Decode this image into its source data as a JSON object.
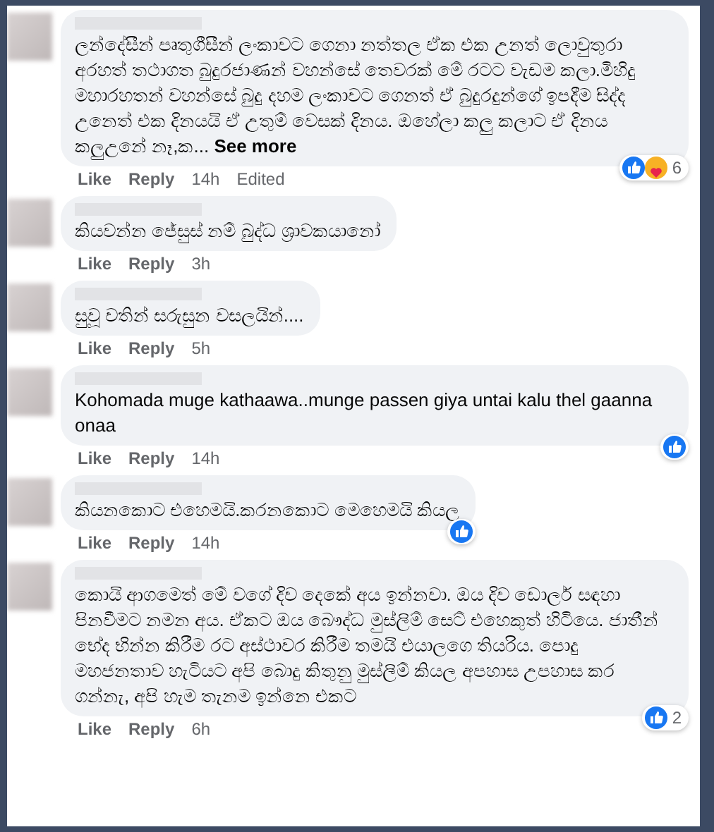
{
  "comments": [
    {
      "text": "ලන්දේසීන් පෘතුගීසීන් ලංකාවට ගෙනා නත්තල ඒක එක උනත් ලොවුතුරා අරහත් තථාගත බුදුරජාණන් වහන්සේ තෙවරක් මේ රටට වැඩම කලා.මිහිදු මහාරහතන් වහන්සේ බුදු දහම ලංකාවට ගෙනත් ඒ බුදුරදුන්ගේ ඉපදීම සිද්ද උනෙත් එක දිනයයි ඒ උතුම් වෙසක් දිනය. ඔහේලා කලු කලාට ඒ දිනය කලුඋනේ නෑ,ක...",
      "see_more": "See more",
      "like": "Like",
      "reply": "Reply",
      "time": "14h",
      "edited": "Edited",
      "reactions": [
        {
          "kind": "like"
        },
        {
          "kind": "care"
        }
      ],
      "reaction_count": "6"
    },
    {
      "text": "කියවන්න ජේසුස් නම් බුද්ධ ශ්‍රාවකයානෝ",
      "like": "Like",
      "reply": "Reply",
      "time": "3h"
    },
    {
      "text": "සුවූ වතින් සරුසුන වසලයින්....",
      "like": "Like",
      "reply": "Reply",
      "time": "5h"
    },
    {
      "text": "Kohomada muge kathaawa..munge passen giya untai kalu thel gaanna onaa",
      "like": "Like",
      "reply": "Reply",
      "time": "14h",
      "reactions": [
        {
          "kind": "like"
        }
      ]
    },
    {
      "text": "කියනකොට එහෙමයි.කරනකොට මෙහෙමයි කියල",
      "like": "Like",
      "reply": "Reply",
      "time": "14h",
      "reactions": [
        {
          "kind": "like"
        }
      ]
    },
    {
      "text": "කොයි ආගමෙත් මේ වගේ දිව දෙකේ අය ඉන්නවා. ඔය දිව ඩොලර් සඳහා පිනවීමට නමන අය. ඒකට ඔය බෞද්ධ මුස්ලිම් සෙට් එහෙකුත් හිටියෙ. ජාතීන් භේද භින්න කිරීම රට අස්ථාවර කිරීම තමයි එයාලගෙ තියරිය. පොදු මහජනතාව හැටියට අපි බොදු කිතුනු මුස්ලිම් කියල අපහාස උපහාස කර ගන්නැ, අපි හැම තැනම ඉන්නෙ එකට",
      "like": "Like",
      "reply": "Reply",
      "time": "6h",
      "reactions": [
        {
          "kind": "like"
        }
      ],
      "reaction_count": "2"
    }
  ]
}
